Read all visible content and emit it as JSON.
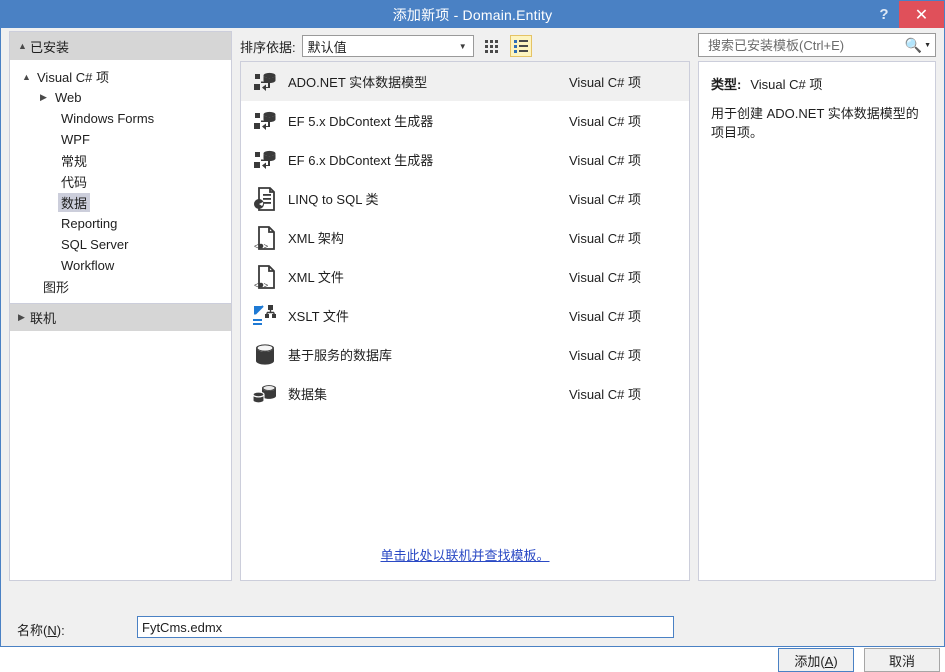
{
  "window": {
    "title": "添加新项 - Domain.Entity",
    "help_icon": "?",
    "close_icon": "✕"
  },
  "sidebar": {
    "installed_header": "已安装",
    "online_header": "联机",
    "tree": [
      {
        "label": "Visual C# 项",
        "indent": 1,
        "arrow": "expanded",
        "selected": false
      },
      {
        "label": "Web",
        "indent": 2,
        "arrow": "collapsed",
        "selected": false
      },
      {
        "label": "Windows Forms",
        "indent": 2,
        "arrow": "none",
        "selected": false
      },
      {
        "label": "WPF",
        "indent": 2,
        "arrow": "none",
        "selected": false
      },
      {
        "label": "常规",
        "indent": 2,
        "arrow": "none",
        "selected": false
      },
      {
        "label": "代码",
        "indent": 2,
        "arrow": "none",
        "selected": false
      },
      {
        "label": "数据",
        "indent": 2,
        "arrow": "none",
        "selected": true
      },
      {
        "label": "Reporting",
        "indent": 2,
        "arrow": "none",
        "selected": false
      },
      {
        "label": "SQL Server",
        "indent": 2,
        "arrow": "none",
        "selected": false
      },
      {
        "label": "Workflow",
        "indent": 2,
        "arrow": "none",
        "selected": false
      },
      {
        "label": "图形",
        "indent": 1,
        "arrow": "none",
        "selected": false
      }
    ]
  },
  "toolbar": {
    "sort_label": "排序依据:",
    "sort_value": "默认值",
    "grid_view_icon": "grid-view-icon",
    "list_view_icon": "list-view-icon"
  },
  "search": {
    "placeholder": "搜索已安装模板(Ctrl+E)",
    "value": "",
    "icon": "search-icon"
  },
  "templates": {
    "items": [
      {
        "name": "ADO.NET 实体数据模型",
        "kind": "Visual C# 项",
        "icon": "entity-data-model-icon",
        "selected": true
      },
      {
        "name": "EF 5.x DbContext 生成器",
        "kind": "Visual C# 项",
        "icon": "entity-data-model-icon",
        "selected": false
      },
      {
        "name": "EF 6.x DbContext 生成器",
        "kind": "Visual C# 项",
        "icon": "entity-data-model-icon",
        "selected": false
      },
      {
        "name": "LINQ to SQL 类",
        "kind": "Visual C# 项",
        "icon": "linq-to-sql-icon",
        "selected": false
      },
      {
        "name": "XML 架构",
        "kind": "Visual C# 项",
        "icon": "xml-file-icon",
        "selected": false
      },
      {
        "name": "XML 文件",
        "kind": "Visual C# 项",
        "icon": "xml-file-icon",
        "selected": false
      },
      {
        "name": "XSLT 文件",
        "kind": "Visual C# 项",
        "icon": "xslt-file-icon",
        "selected": false
      },
      {
        "name": "基于服务的数据库",
        "kind": "Visual C# 项",
        "icon": "database-icon",
        "selected": false
      },
      {
        "name": "数据集",
        "kind": "Visual C# 项",
        "icon": "dataset-icon",
        "selected": false
      }
    ],
    "online_link": "单击此处以联机并查找模板。"
  },
  "details": {
    "type_label": "类型:",
    "type_value": "Visual C# 项",
    "description": "用于创建 ADO.NET 实体数据模型的项目项。"
  },
  "footer": {
    "name_label_prefix": "名称(",
    "name_label_accel": "N",
    "name_label_suffix": "):",
    "name_value": "FytCms.edmx",
    "add_prefix": "添加(",
    "add_accel": "A",
    "add_suffix": ")",
    "cancel_label": "取消"
  },
  "colors": {
    "title_bar": "#4a81c4",
    "close_button": "#e0505a",
    "selection": "#cccedb",
    "link": "#2a49c4",
    "toggle_active": "#fdf4bf"
  }
}
